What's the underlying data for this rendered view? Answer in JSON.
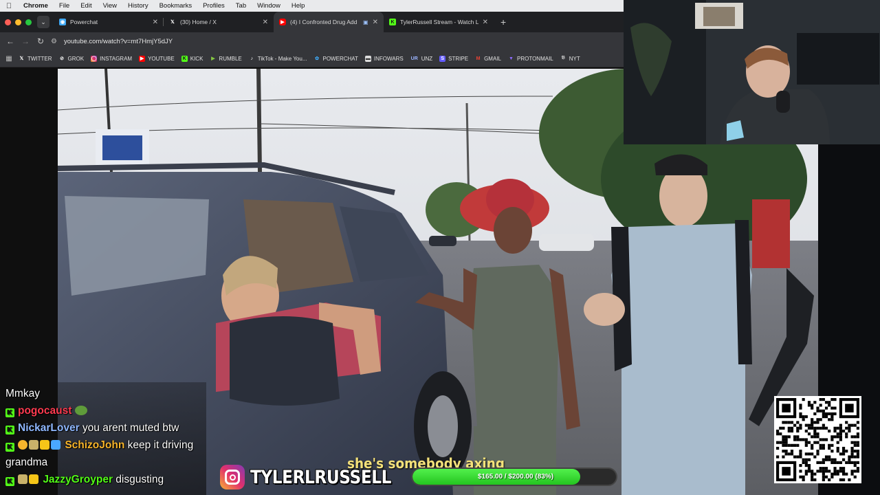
{
  "menubar": {
    "app": "Chrome",
    "items": [
      "File",
      "Edit",
      "View",
      "History",
      "Bookmarks",
      "Profiles",
      "Tab",
      "Window",
      "Help"
    ]
  },
  "tabs": [
    {
      "title": "Powerchat",
      "icon": "powerchat-icon",
      "active": false
    },
    {
      "title": "(30) Home / X",
      "icon": "x-icon",
      "active": false
    },
    {
      "title": "(4) I Confronted Drug Add",
      "icon": "youtube-icon",
      "active": true
    },
    {
      "title": "TylerRussell Stream - Watch L",
      "icon": "kick-icon",
      "active": false
    }
  ],
  "address": {
    "url": "youtube.com/watch?v=mt7HmjY5dJY"
  },
  "bookmarks": [
    {
      "label": "TWITTER",
      "icon": "x-icon",
      "color": "#111111"
    },
    {
      "label": "GROK",
      "icon": "grok-icon",
      "color": "#222222"
    },
    {
      "label": "INSTAGRAM",
      "icon": "instagram-icon",
      "color": "#e1306c"
    },
    {
      "label": "YOUTUBE",
      "icon": "youtube-icon",
      "color": "#ff0000"
    },
    {
      "label": "KICK",
      "icon": "kick-icon",
      "color": "#53fc18"
    },
    {
      "label": "RUMBLE",
      "icon": "rumble-icon",
      "color": "#85c742"
    },
    {
      "label": "TikTok - Make You...",
      "icon": "tiktok-icon",
      "color": "#111111"
    },
    {
      "label": "POWERCHAT",
      "icon": "powerchat-icon",
      "color": "#3fa9f5"
    },
    {
      "label": "INFOWARS",
      "icon": "infowars-icon",
      "color": "#dddddd"
    },
    {
      "label": "UNZ",
      "icon": "unz-icon",
      "color": "#2b4c9b",
      "glyph": "UR"
    },
    {
      "label": "STRIPE",
      "icon": "stripe-icon",
      "color": "#635bff"
    },
    {
      "label": "GMAIL",
      "icon": "gmail-icon",
      "color": "#ea4335"
    },
    {
      "label": "PROTONMAIL",
      "icon": "protonmail-icon",
      "color": "#6d4aff"
    },
    {
      "label": "NYT",
      "icon": "nyt-icon",
      "color": "#dddddd"
    }
  ],
  "chat": {
    "first_line": "Mmkay",
    "messages": [
      {
        "user": "pogocaust",
        "user_color": "#ff3b50",
        "text": "",
        "badges": [
          "kick"
        ],
        "emote": "pepe-emote"
      },
      {
        "user": "NickarLover",
        "user_color": "#8fb8ff",
        "text": "you arent muted btw",
        "badges": [
          "kick"
        ]
      },
      {
        "user": "SchizoJohn",
        "user_color": "#f7b52c",
        "text": "keep it driving grandma",
        "badges": [
          "kick",
          "sub",
          "gift",
          "crown",
          "sword"
        ]
      },
      {
        "user": "JazzyGroyper",
        "user_color": "#53fc18",
        "text": "disgusting",
        "badges": [
          "kick",
          "gift",
          "crown"
        ]
      }
    ]
  },
  "overlay": {
    "instagram_handle": "TYLERLRUSSELL",
    "caption": "she's somebody axing",
    "goal_text": "$165.00 / $200.00 (83%)",
    "goal_fraction": 0.825
  }
}
